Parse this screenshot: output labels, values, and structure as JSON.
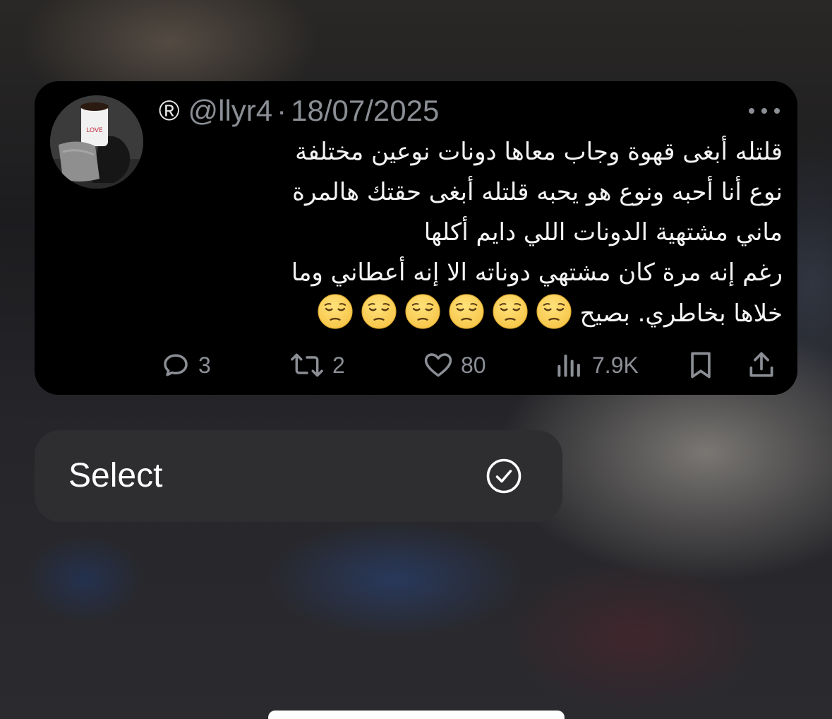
{
  "tweet": {
    "author_icon": "®",
    "handle": "@llyr4",
    "separator": "·",
    "date": "18/07/2025",
    "text_lines": [
      "قلتله أبغى قهوة وجاب معاها دونات نوعين مختلفة",
      "نوع أنا أحبه ونوع هو يحبه قلتله أبغى حقتك هالمرة",
      "ماني مشتهية الدونات اللي دايم أكلها",
      "رغم إنه مرة كان مشتهي دوناته الا إنه أعطاني وما",
      "خلاها بخاطري. بصيح"
    ],
    "emoji": "pensive-face",
    "emoji_count": 6,
    "actions": {
      "replies": "3",
      "reposts": "2",
      "likes": "80",
      "views": "7.9K"
    }
  },
  "menu": {
    "select_label": "Select"
  },
  "icons": {
    "more": "more-horizontal-icon",
    "reply": "reply-icon",
    "repost": "repost-icon",
    "like": "heart-icon",
    "views": "views-icon",
    "bookmark": "bookmark-icon",
    "share": "share-icon",
    "select": "checkmark-circle-icon"
  },
  "colors": {
    "card_background": "#000000",
    "secondary_text": "#8b8f95",
    "primary_text": "#f4f4f4",
    "menu_background": "#2e2e30",
    "emoji_yellow": "#f7c64a"
  }
}
